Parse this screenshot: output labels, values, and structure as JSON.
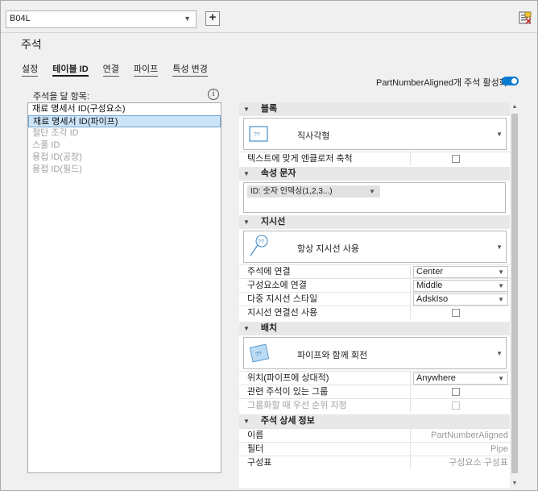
{
  "toolbar": {
    "style_name": "B04L",
    "add_label": "+"
  },
  "page_title": "주석",
  "tabs": [
    {
      "label": "설정"
    },
    {
      "label": "테이블 ID"
    },
    {
      "label": "연결"
    },
    {
      "label": "파이프"
    },
    {
      "label": "특성 변경"
    }
  ],
  "toggle": {
    "label": "PartNumberAligned개 주석 활성화:",
    "on": true
  },
  "left": {
    "label": "주석을 달 항목:",
    "items": [
      {
        "label": "재료 명세서 ID(구성요소)",
        "state": "normal"
      },
      {
        "label": "재료 명세서 ID(파이프)",
        "state": "selected"
      },
      {
        "label": "절단 조각 ID",
        "state": "disabled"
      },
      {
        "label": "스풀 ID",
        "state": "disabled"
      },
      {
        "label": "용접 ID(공장)",
        "state": "disabled"
      },
      {
        "label": "용접 ID(필드)",
        "state": "disabled"
      }
    ]
  },
  "sections": {
    "block": {
      "title": "블록",
      "style_name": "직사각형",
      "rows": [
        {
          "key": "텍스트에 맞게 엔클로저 축척",
          "value_type": "checkbox"
        }
      ]
    },
    "attr": {
      "title": "속성 문자",
      "chip": "ID: 숫자 인덱싱(1,2,3...)"
    },
    "leader": {
      "title": "지시선",
      "style_name": "항상 지시선 사용",
      "rows": [
        {
          "key": "주석에 연결",
          "value": "Center"
        },
        {
          "key": "구성요소에 연결",
          "value": "Middle"
        },
        {
          "key": "다중 지시선 스타일",
          "value": "AdskIso"
        },
        {
          "key": "지시선 연결선 사용"
        }
      ]
    },
    "placement": {
      "title": "배치",
      "style_name": "파이프와 함께 회전",
      "rows": [
        {
          "key": "위치(파이프에 상대적)",
          "value": "Anywhere"
        },
        {
          "key": "관련 주석이 있는 그룹"
        },
        {
          "key": "그룹화할 때 우선 순위 지정"
        }
      ]
    },
    "details": {
      "title": "주석 상세 정보",
      "rows": [
        {
          "key": "이름",
          "value": "PartNumberAligned"
        },
        {
          "key": "필터",
          "value": "Pipe"
        },
        {
          "key": "구성표",
          "value": "구성요소 구성표"
        }
      ]
    }
  },
  "colors": {
    "accent": "#0b7ad1",
    "selection": "#cce4f7"
  }
}
